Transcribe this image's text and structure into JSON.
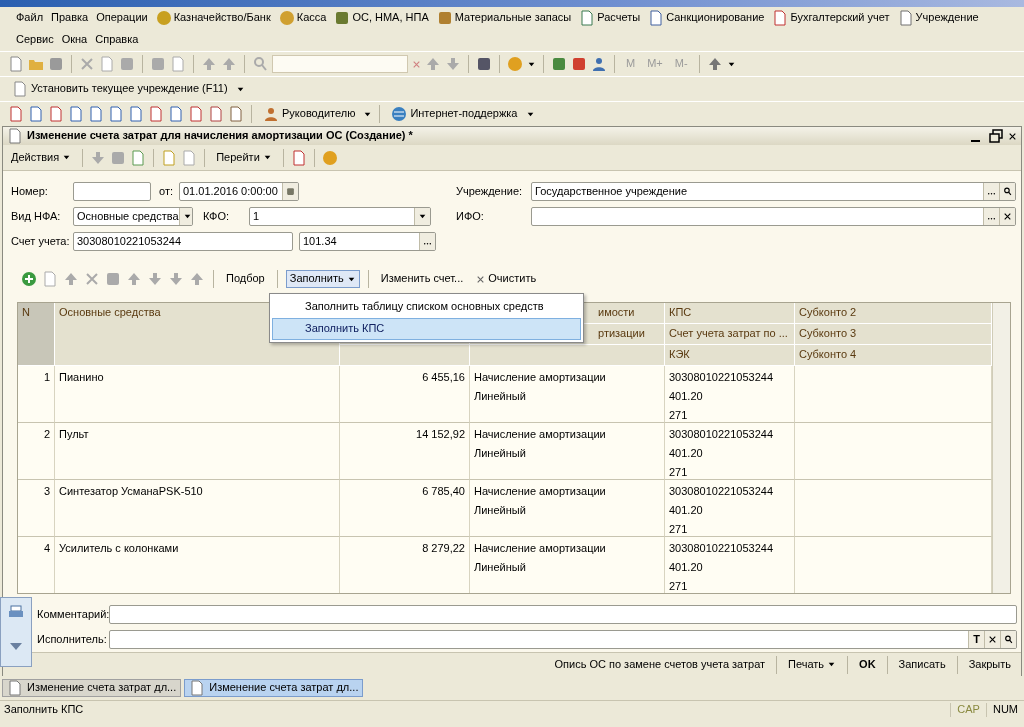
{
  "menu_rows": [
    [
      {
        "label": "Файл",
        "has_icon": false
      },
      {
        "label": "Правка",
        "has_icon": false
      },
      {
        "label": "Операции",
        "has_icon": false
      },
      {
        "label": "Казначейство/Банк",
        "has_icon": true
      },
      {
        "label": "Касса",
        "has_icon": true
      },
      {
        "label": "ОС, НМА, НПА",
        "has_icon": true
      },
      {
        "label": "Материальные запасы",
        "has_icon": true
      },
      {
        "label": "Расчеты",
        "has_icon": true
      },
      {
        "label": "Санкционирование",
        "has_icon": true
      },
      {
        "label": "Бухгалтерский учет",
        "has_icon": true
      },
      {
        "label": "Учреждение",
        "has_icon": true
      }
    ],
    [
      {
        "label": "Сервис",
        "has_icon": false
      },
      {
        "label": "Окна",
        "has_icon": false
      },
      {
        "label": "Справка",
        "has_icon": false
      }
    ]
  ],
  "toolbar": {
    "memory_buttons": [
      "M",
      "M+",
      "M-"
    ]
  },
  "institution_button": "Установить текущее учреждение (F11)",
  "report_toolbar": {
    "buttons": [
      "Руководителю",
      "Интернет-поддержка"
    ]
  },
  "document": {
    "title": "Изменение счета затрат для начисления амортизации ОС (Создание) *",
    "toolbar": {
      "actions": "Действия",
      "goto": "Перейти"
    },
    "fields": {
      "number": {
        "label": "Номер:"
      },
      "date": {
        "label": "от:",
        "value": "01.01.2016  0:00:00"
      },
      "institution": {
        "label": "Учреждение:",
        "value": "Государственное учреждение"
      },
      "nfa_type": {
        "label": "Вид НФА:",
        "value": "Основные средства"
      },
      "kfo": {
        "label": "КФО:",
        "value": "1"
      },
      "ifo": {
        "label": "ИФО:"
      },
      "account": {
        "label": "Счет учета:",
        "value": "30308010221053244",
        "code": "101.34"
      }
    },
    "table_toolbar": {
      "pick": "Подбор",
      "fill": {
        "label": "Заполнить",
        "pressed": true
      },
      "change": "Изменить счет...",
      "clear": "Очистить"
    },
    "fill_menu": [
      {
        "label": "Заполнить таблицу списком основных средств",
        "selected": false
      },
      {
        "label": "Заполнить КПС",
        "selected": true
      }
    ],
    "table": {
      "columns": [
        {
          "headers": [
            "N"
          ]
        },
        {
          "headers": [
            "Основные средства"
          ]
        },
        {},
        {
          "headers": [
            "имости",
            "ртизации"
          ]
        },
        {
          "headers": [
            "КПС",
            "Счет учета затрат по ...",
            "КЭК"
          ]
        },
        {
          "headers": [
            "Субконто 2",
            "Субконто 3",
            "Субконто 4"
          ]
        }
      ],
      "rows": [
        {
          "n": "1",
          "asset": "Пианино",
          "amount": "6 455,16",
          "method": [
            "Начисление амортизации",
            "Линейный"
          ],
          "kps": [
            "30308010221053244",
            "401.20",
            "271"
          ]
        },
        {
          "n": "2",
          "asset": "Пульт",
          "amount": "14 152,92",
          "method": [
            "Начисление амортизации",
            "Линейный"
          ],
          "kps": [
            "30308010221053244",
            "401.20",
            "271"
          ]
        },
        {
          "n": "3",
          "asset": "Синтезатор УсманаPSK-510",
          "amount": "6 785,40",
          "method": [
            "Начисление амортизации",
            "Линейный"
          ],
          "kps": [
            "30308010221053244",
            "401.20",
            "271"
          ]
        },
        {
          "n": "4",
          "asset": "Усилитель с колонками",
          "amount": "8 279,22",
          "method": [
            "Начисление амортизации",
            "Линейный"
          ],
          "kps": [
            "30308010221053244",
            "401.20",
            "271"
          ]
        }
      ]
    },
    "comment": {
      "label": "Комментарий:"
    },
    "executor": {
      "label": "Исполнитель:",
      "type_button": "T"
    },
    "footer_buttons": [
      {
        "label": "Опись ОС по замене счетов учета затрат",
        "kind": "link"
      },
      {
        "label": "Печать",
        "kind": "dropdown"
      },
      {
        "label": "OK",
        "kind": "default"
      },
      {
        "label": "Записать",
        "kind": "plain"
      },
      {
        "label": "Закрыть",
        "kind": "plain"
      }
    ]
  },
  "taskbar": [
    {
      "label": "Изменение счета затрат дл...",
      "selected": false
    },
    {
      "label": "Изменение счета затрат дл...",
      "selected": true
    }
  ],
  "status_bar": {
    "message": "Заполнить КПС",
    "indicators": [
      {
        "label": "CAP",
        "on": false
      },
      {
        "label": "NUM",
        "on": true
      }
    ]
  }
}
